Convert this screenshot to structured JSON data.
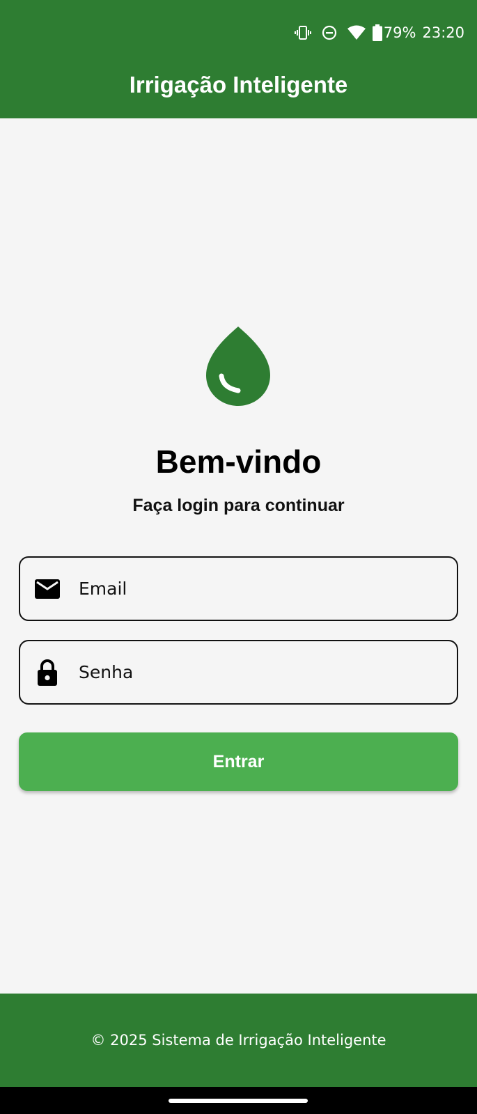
{
  "status_bar": {
    "battery_percent": "79%",
    "time": "23:20",
    "icons": [
      "vibrate-icon",
      "do-not-disturb-icon",
      "wifi-icon",
      "battery-icon"
    ]
  },
  "appbar": {
    "title": "Irrigação Inteligente"
  },
  "logo": {
    "icon": "water-drop-icon"
  },
  "login": {
    "heading": "Bem-vindo",
    "subtitle": "Faça login para continuar",
    "email_placeholder": "Email",
    "email_icon": "mail-icon",
    "password_placeholder": "Senha",
    "password_icon": "lock-icon",
    "submit_label": "Entrar"
  },
  "footer": {
    "text": "© 2025 Sistema de Irrigação Inteligente"
  },
  "colors": {
    "primary": "#2e7d32",
    "button": "#4caf50",
    "background": "#f5f5f5"
  }
}
